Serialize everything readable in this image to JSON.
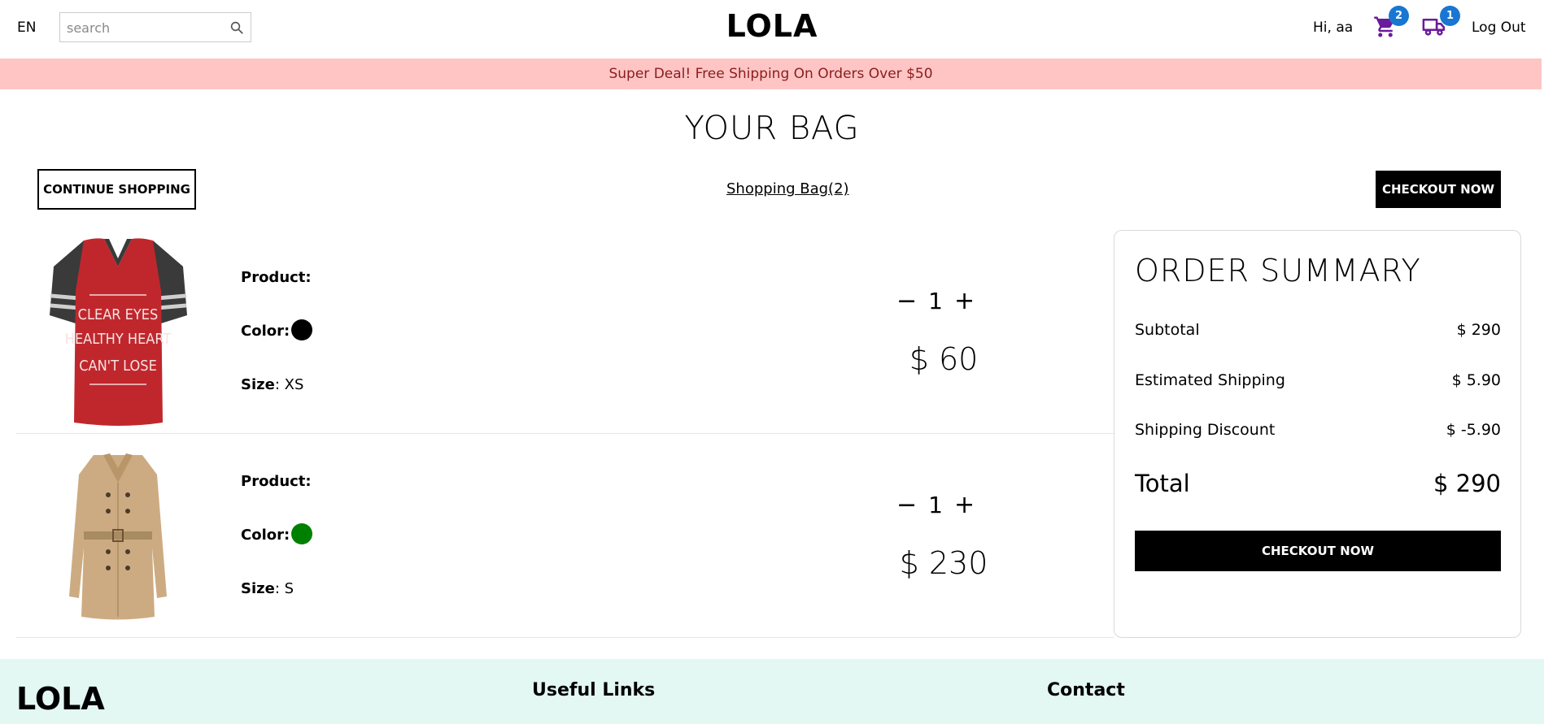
{
  "navbar": {
    "language": "EN",
    "search_placeholder": "search",
    "logo": "LOLA",
    "greeting": "Hi, aa",
    "cart_count": "2",
    "orders_count": "1",
    "logout_label": "Log Out"
  },
  "announcement": "Super Deal! Free Shipping On Orders Over $50",
  "bag": {
    "title": "YOUR BAG",
    "continue_label": "CONTINUE SHOPPING",
    "bag_link": "Shopping Bag(2)",
    "checkout_label": "CHECKOUT NOW"
  },
  "products": [
    {
      "product_label": "Product:",
      "color_label": "Color:",
      "color": "#000000",
      "size_label": "Size",
      "size": "XS",
      "quantity": "1",
      "price": "$ 60"
    },
    {
      "product_label": "Product:",
      "color_label": "Color:",
      "color": "#008000",
      "size_label": "Size",
      "size": "S",
      "quantity": "1",
      "price": "$ 230"
    }
  ],
  "summary": {
    "title": "ORDER SUMMARY",
    "subtotal_label": "Subtotal",
    "subtotal": "$ 290",
    "shipping_label": "Estimated Shipping",
    "shipping": "$ 5.90",
    "discount_label": "Shipping Discount",
    "discount": "$ -5.90",
    "total_label": "Total",
    "total": "$ 290",
    "checkout_label": "CHECKOUT NOW"
  },
  "footer": {
    "logo": "LOLA",
    "useful_links": "Useful Links",
    "contact": "Contact"
  },
  "colors": {
    "announcement_bg": "#ffc5c5",
    "badge": "#1976d2",
    "icon": "#6a1b9a",
    "footer_bg": "#e3f7f3"
  },
  "icons": [
    "search-icon",
    "cart-icon",
    "truck-icon",
    "minus-icon",
    "plus-icon"
  ]
}
